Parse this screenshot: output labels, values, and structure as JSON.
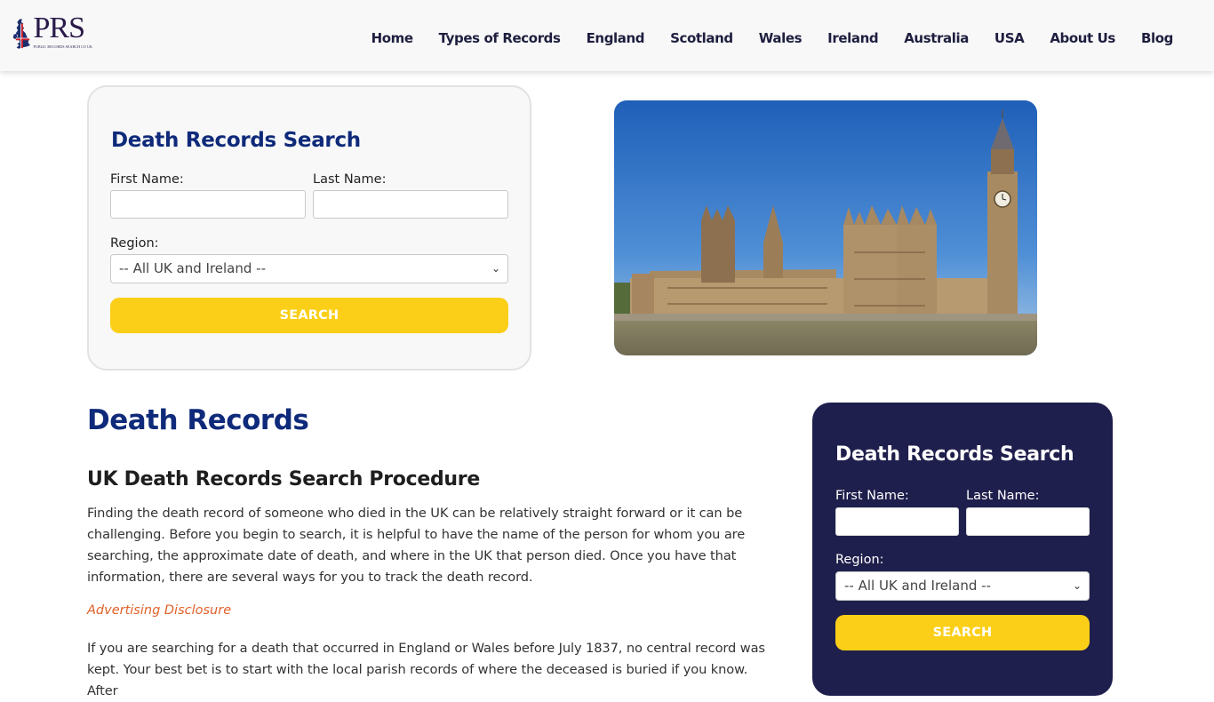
{
  "header": {
    "logo": {
      "text": "PRS",
      "subtitle": "PUBLIC RECORDS SEARCH CO UK"
    },
    "nav": [
      {
        "label": "Home"
      },
      {
        "label": "Types of Records"
      },
      {
        "label": "England"
      },
      {
        "label": "Scotland"
      },
      {
        "label": "Wales"
      },
      {
        "label": "Ireland"
      },
      {
        "label": "Australia"
      },
      {
        "label": "USA"
      },
      {
        "label": "About Us"
      },
      {
        "label": "Blog"
      }
    ]
  },
  "search_top": {
    "title": "Death Records Search",
    "first_name_label": "First Name:",
    "first_name_value": "",
    "last_name_label": "Last Name:",
    "last_name_value": "",
    "region_label": "Region:",
    "region_selected": "-- All UK and Ireland --",
    "button_label": "SEARCH"
  },
  "hero_image": {
    "alt": "Houses of Parliament and Big Ben, London"
  },
  "main": {
    "title": "Death Records",
    "subtitle": "UK Death Records Search Procedure",
    "paragraph1": "Finding the death record of someone who died in the UK can be relatively straight forward or it can be challenging. Before you begin to search, it is helpful to have the name of the person for whom you are searching, the approximate date of death, and where in the UK that person died. Once you have that information, there are several ways for you to track the death record.",
    "disclosure": "Advertising Disclosure",
    "paragraph2": "If you are searching for a death that occurred in England or Wales before July 1837, no central record was kept. Your best bet is to start with the local parish records of where the deceased is buried if you know. After"
  },
  "search_side": {
    "title": "Death Records Search",
    "first_name_label": "First Name:",
    "first_name_value": "",
    "last_name_label": "Last Name:",
    "last_name_value": "",
    "region_label": "Region:",
    "region_selected": "-- All UK and Ireland --",
    "button_label": "SEARCH"
  },
  "colors": {
    "brand_navy": "#0f2a7a",
    "sidebar_bg": "#1f1f4d",
    "button_yellow": "#fbcf17",
    "disclosure_orange": "#e0612b"
  }
}
